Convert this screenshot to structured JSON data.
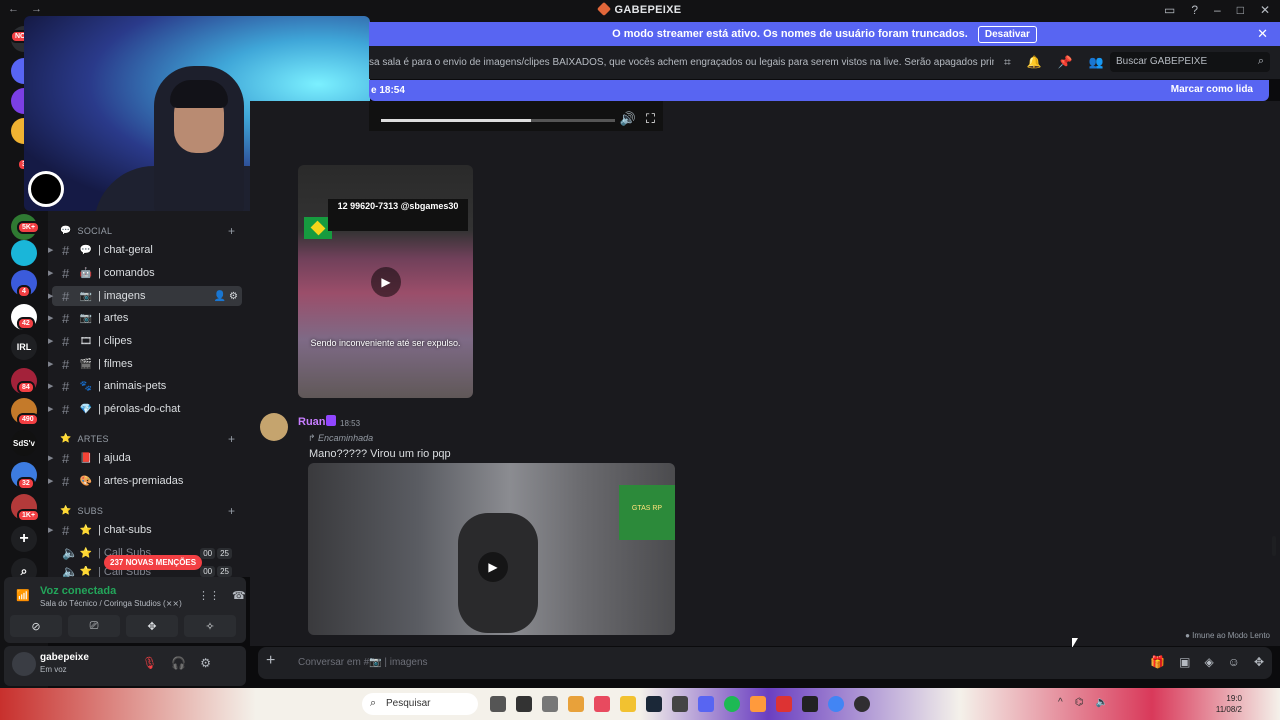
{
  "titlebar": {
    "title": "GABEPEIXE",
    "back": "←",
    "forward": "→"
  },
  "streamer": {
    "message": "O modo streamer está ativo. Os nomes de usuário foram truncados.",
    "button": "Desativar",
    "close": "✕"
  },
  "topic": {
    "text": "sa sala é para o envio de imagens/clipes BAIXADOS, que vocês achem engraçados ou legais para serem vistos na live. Serão apagados prints de outras rede...",
    "search_placeholder": "Buscar GABEPEIXE"
  },
  "new_messages": {
    "since": "e 18:54",
    "mark_read": "Marcar como lida"
  },
  "guild_badges": [
    "NO",
    "363",
    "5K+",
    "4",
    "42",
    "84",
    "490",
    "32",
    "1K+"
  ],
  "guild_labels": {
    "irl": "IRL",
    "sdsv": "SdS'v"
  },
  "categories": {
    "social": "SOCIAL",
    "artes": "ARTES",
    "subs": "SUBS"
  },
  "channels": {
    "social": [
      {
        "emoji": "💬",
        "name": "| chat-geral"
      },
      {
        "emoji": "🤖",
        "name": "| comandos"
      },
      {
        "emoji": "📷",
        "name": "| imagens"
      },
      {
        "emoji": "📷",
        "name": "| artes"
      },
      {
        "emoji": "🎞",
        "name": "| clipes"
      },
      {
        "emoji": "🎬",
        "name": "| filmes"
      },
      {
        "emoji": "🐾",
        "name": "| animais-pets"
      },
      {
        "emoji": "💎",
        "name": "| pérolas-do-chat"
      }
    ],
    "artes": [
      {
        "emoji": "📕",
        "name": "| ajuda"
      },
      {
        "emoji": "🎨",
        "name": "| artes-premiadas"
      }
    ],
    "subs": [
      {
        "emoji": "⭐",
        "name": "| chat-subs"
      },
      {
        "emoji": "⭐",
        "name": "| Call Subs",
        "counts": [
          "00",
          "25"
        ]
      },
      {
        "emoji": "⭐",
        "name": "| Call Subs",
        "counts": [
          "00",
          "25"
        ]
      }
    ]
  },
  "mentions": "237 NOVAS MENÇÕES",
  "voice": {
    "status": "Voz conectada",
    "room": "Sala do Técnico / Coringa Studios (⨯⨯)"
  },
  "user": {
    "name": "gabepeixe",
    "status": "Em voz"
  },
  "messages": {
    "img1_caption": "Sendo inconveniente até ser expulso.",
    "img1_sign": "12 99620-7313 @sbgames30",
    "author": "Ruan",
    "time": "18:53",
    "forwarded": "Encaminhada",
    "text": "Mano????? Virou um rio pqp",
    "img2_ad": "GTAS RP"
  },
  "slowmode": "Imune ao Modo Lento",
  "composer": {
    "placeholder": "Conversar em #📷 | imagens"
  },
  "taskbar": {
    "search": "Pesquisar",
    "time": "19:0",
    "date": "11/08/2"
  },
  "colors": {
    "accent": "#5865f2",
    "danger": "#f23f43",
    "online": "#23a55a"
  }
}
